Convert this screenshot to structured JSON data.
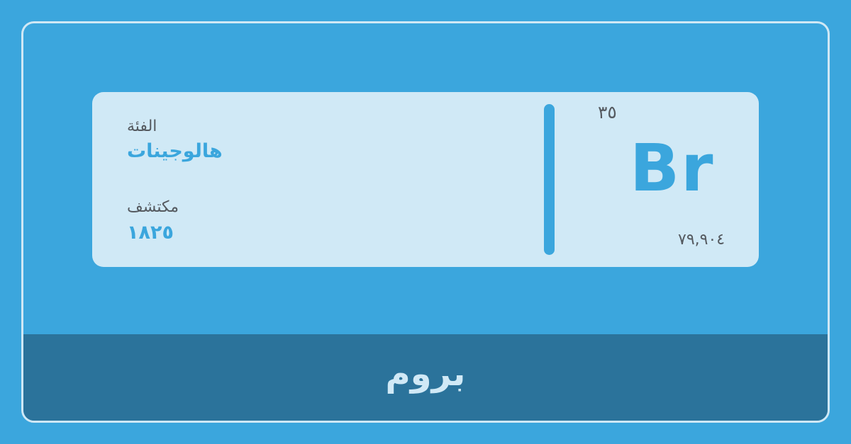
{
  "card": {
    "category_label": "الفئة",
    "category_value": "هالوجينات",
    "discoverer_label": "مكتشف",
    "discoverer_value": "١٨٢٥",
    "atomic_number": "٣٥",
    "symbol": "Br",
    "atomic_mass": "٧٩,٩٠٤"
  },
  "footer": {
    "element_name": "بروم"
  },
  "colors": {
    "background": "#3ba6dd",
    "card": "#d0e9f6",
    "footer": "#2b739b",
    "accent": "#3ba6dd",
    "text_muted": "#555a60"
  }
}
